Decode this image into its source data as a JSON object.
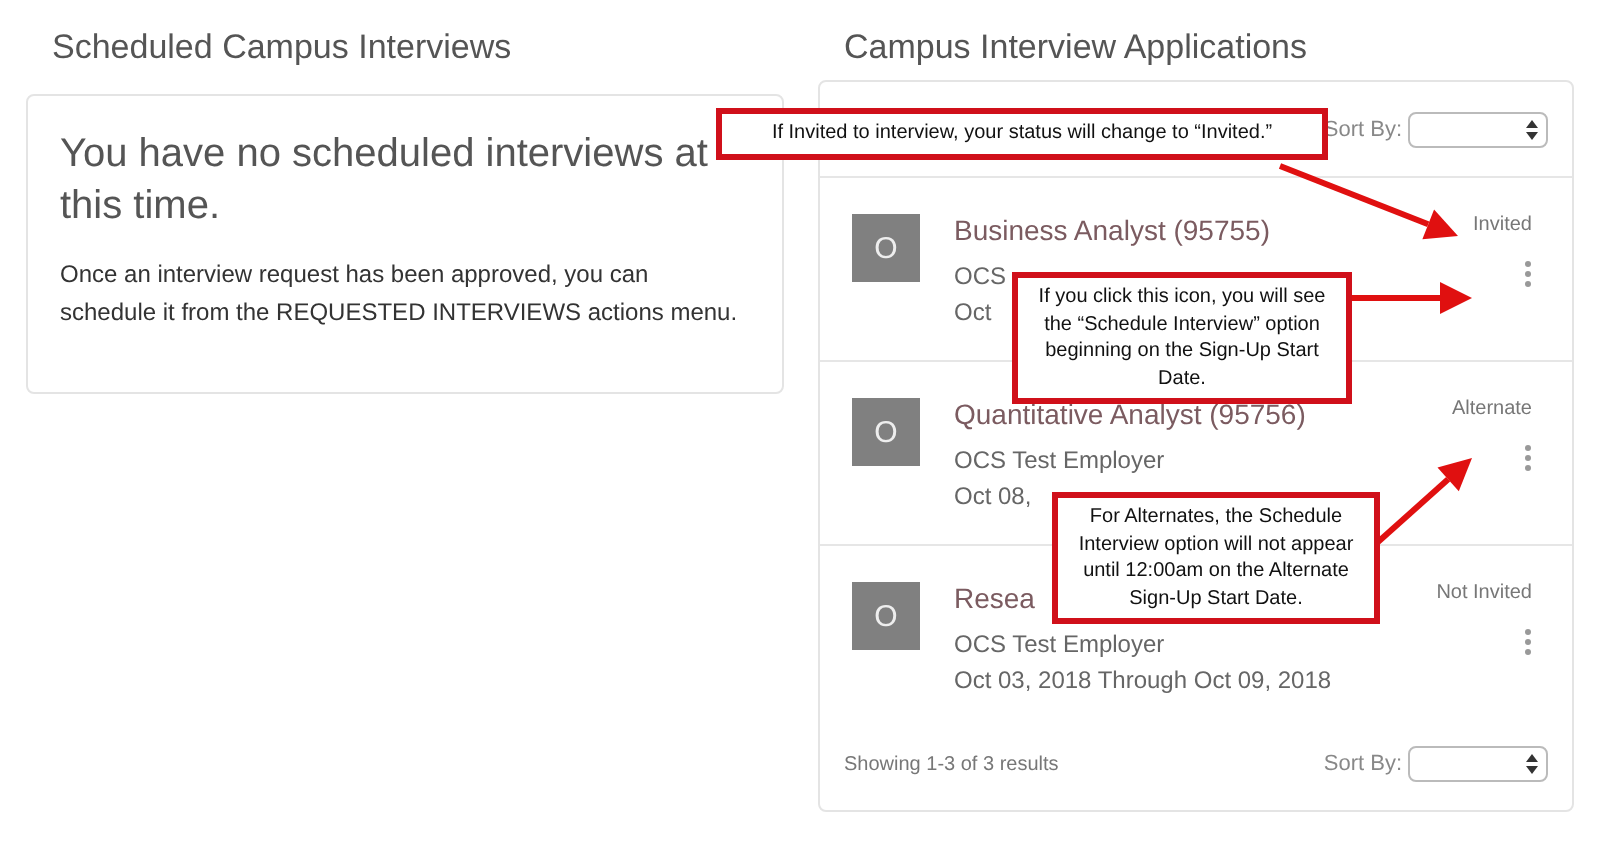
{
  "scheduled": {
    "heading": "Scheduled Campus Interviews",
    "empty_title": "You have no scheduled interviews at this time.",
    "empty_text": "Once an interview request has been approved, you can schedule it from the REQUESTED INTERVIEWS actions menu."
  },
  "applications": {
    "heading": "Campus Interview Applications",
    "sort_label": "Sort By:",
    "rows": [
      {
        "avatar": "O",
        "title": "Business Analyst (95755)",
        "employer": "OCS",
        "dates": "Oct",
        "status": "Invited"
      },
      {
        "avatar": "O",
        "title": "Quantitative Analyst (95756)",
        "employer": "OCS Test Employer",
        "dates": "Oct 08,",
        "status": "Alternate"
      },
      {
        "avatar": "O",
        "title": "Resea",
        "employer": "OCS Test Employer",
        "dates": "Oct 03, 2018 Through Oct 09, 2018",
        "status": "Not Invited"
      }
    ],
    "footer": {
      "results": "Showing 1-3 of 3 results",
      "sort_label": "Sort By:"
    }
  },
  "callouts": [
    {
      "text": "If Invited to interview, your status will change to “Invited.”"
    },
    {
      "text": "If you click this icon, you will see the “Schedule Interview” option beginning on the Sign-Up Start Date."
    },
    {
      "text": "For Alternates, the Schedule Interview option will not appear until 12:00am on the Alternate Sign-Up Start Date."
    }
  ]
}
